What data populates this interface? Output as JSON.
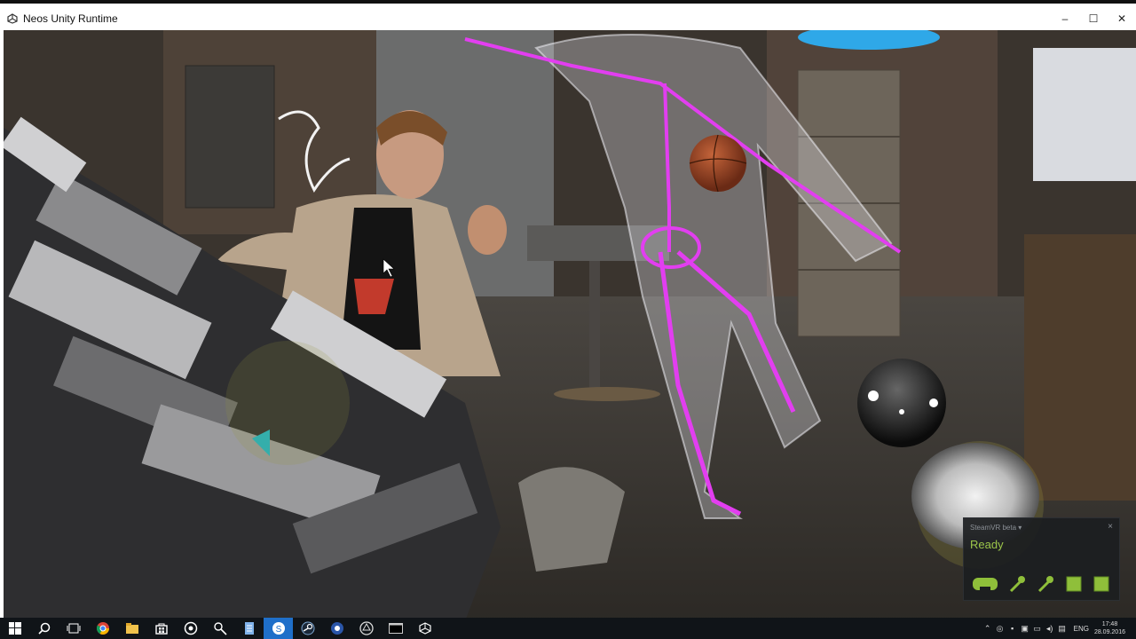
{
  "window": {
    "title": "Neos Unity Runtime",
    "controls": {
      "minimize": "–",
      "maximize": "☐",
      "close": "✕"
    }
  },
  "steamvr": {
    "title": "SteamVR beta ▾",
    "close": "×",
    "status": "Ready",
    "devices": [
      "headset-icon",
      "controller-icon",
      "controller-icon",
      "base-station-icon",
      "base-station-icon"
    ],
    "accent": "#8fbf3a"
  },
  "taskbar": {
    "apps": [
      "start-icon",
      "search-icon",
      "task-view-icon",
      "chrome-icon",
      "file-explorer-icon",
      "store-icon",
      "app-icon",
      "app-icon",
      "notepad-icon",
      "skype-icon",
      "steam-icon",
      "app-icon",
      "unity-icon",
      "terminal-icon",
      "unity-icon"
    ],
    "active_index": 9,
    "tray_icons": [
      "chevron-up-icon",
      "network-icon",
      "app-icon",
      "app-icon",
      "network-icon",
      "speaker-icon",
      "message-icon"
    ],
    "language": "ENG",
    "time": "17:48",
    "date": "28.09.2016"
  },
  "colors": {
    "accent": "#1f6fc9",
    "skeleton": "#e23ef0",
    "status_green": "#9cc64a"
  }
}
